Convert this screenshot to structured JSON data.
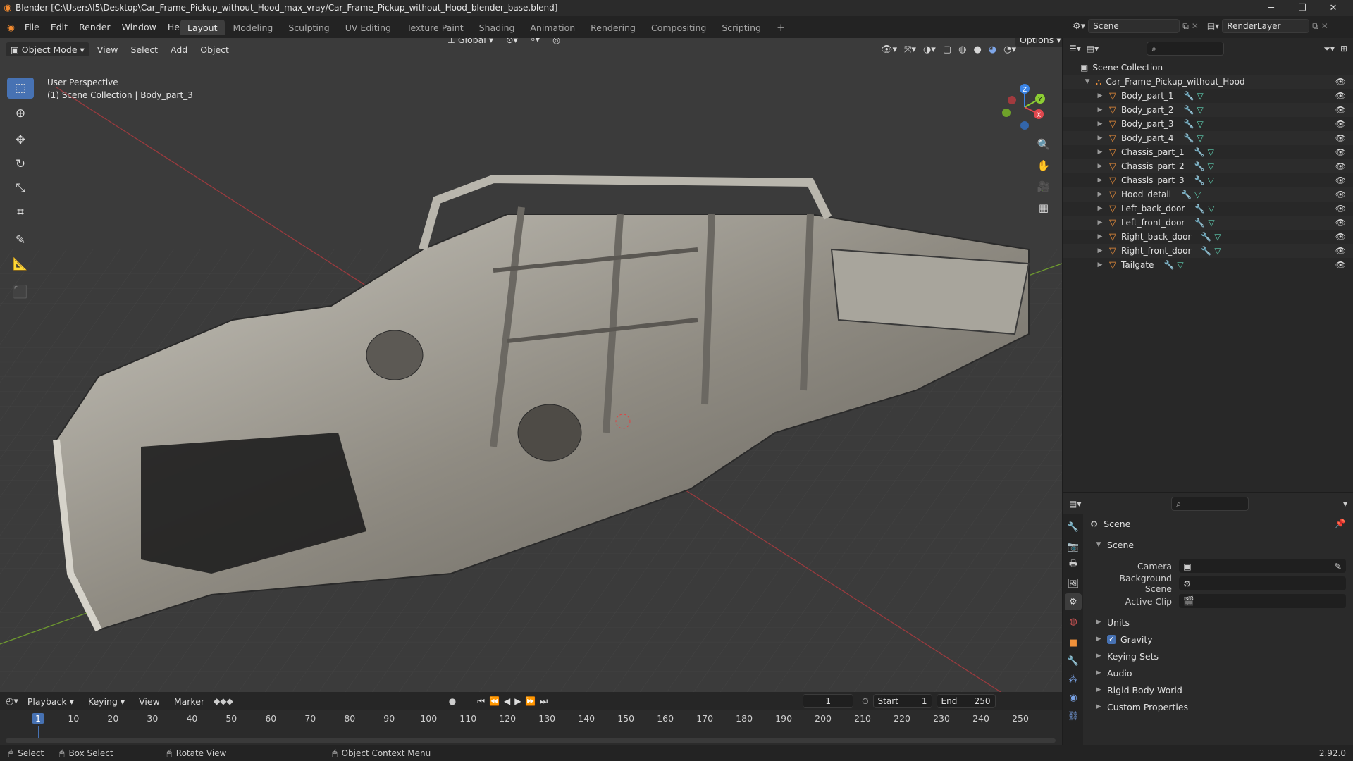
{
  "titlebar": {
    "title": "Blender [C:\\Users\\I5\\Desktop\\Car_Frame_Pickup_without_Hood_max_vray/Car_Frame_Pickup_without_Hood_blender_base.blend]"
  },
  "menu": [
    "File",
    "Edit",
    "Render",
    "Window",
    "Help"
  ],
  "workspaces": [
    "Layout",
    "Modeling",
    "Sculpting",
    "UV Editing",
    "Texture Paint",
    "Shading",
    "Animation",
    "Rendering",
    "Compositing",
    "Scripting"
  ],
  "scene_field": "Scene",
  "renderlayer_field": "RenderLayer",
  "viewport": {
    "mode": "Object Mode",
    "menus": [
      "View",
      "Select",
      "Add",
      "Object"
    ],
    "orientation": "Global",
    "options_label": "Options",
    "info_line1": "User Perspective",
    "info_line2": "(1) Scene Collection | Body_part_3",
    "gizmo": {
      "x": "X",
      "y": "Y",
      "z": "Z"
    }
  },
  "outliner": {
    "root": "Scene Collection",
    "collection": "Car_Frame_Pickup_without_Hood",
    "objects": [
      "Body_part_1",
      "Body_part_2",
      "Body_part_3",
      "Body_part_4",
      "Chassis_part_1",
      "Chassis_part_2",
      "Chassis_part_3",
      "Hood_detail",
      "Left_back_door",
      "Left_front_door",
      "Right_back_door",
      "Right_front_door",
      "Tailgate"
    ]
  },
  "properties": {
    "context": "Scene",
    "panel": "Scene",
    "camera_label": "Camera",
    "bg_scene_label": "Background Scene",
    "active_clip_label": "Active Clip",
    "sections": [
      "Units",
      "Gravity",
      "Keying Sets",
      "Audio",
      "Rigid Body World",
      "Custom Properties"
    ],
    "gravity_checked": true
  },
  "timeline": {
    "menus": [
      "Playback",
      "Keying",
      "View",
      "Marker"
    ],
    "current_frame": "1",
    "start_label": "Start",
    "start": "1",
    "end_label": "End",
    "end": "250",
    "ticks": [
      "1",
      "10",
      "20",
      "30",
      "40",
      "50",
      "60",
      "70",
      "80",
      "90",
      "100",
      "110",
      "120",
      "130",
      "140",
      "150",
      "160",
      "170",
      "180",
      "190",
      "200",
      "210",
      "220",
      "230",
      "240",
      "250"
    ]
  },
  "statusbar": {
    "select": "Select",
    "box_select": "Box Select",
    "rotate_view": "Rotate View",
    "context_menu": "Object Context Menu",
    "version": "2.92.0"
  },
  "colors": {
    "accent": "#4772b3",
    "object_orange": "#f0913a",
    "x_axis": "#e0484e",
    "y_axis": "#8ccd33",
    "z_axis": "#3b84e6"
  }
}
